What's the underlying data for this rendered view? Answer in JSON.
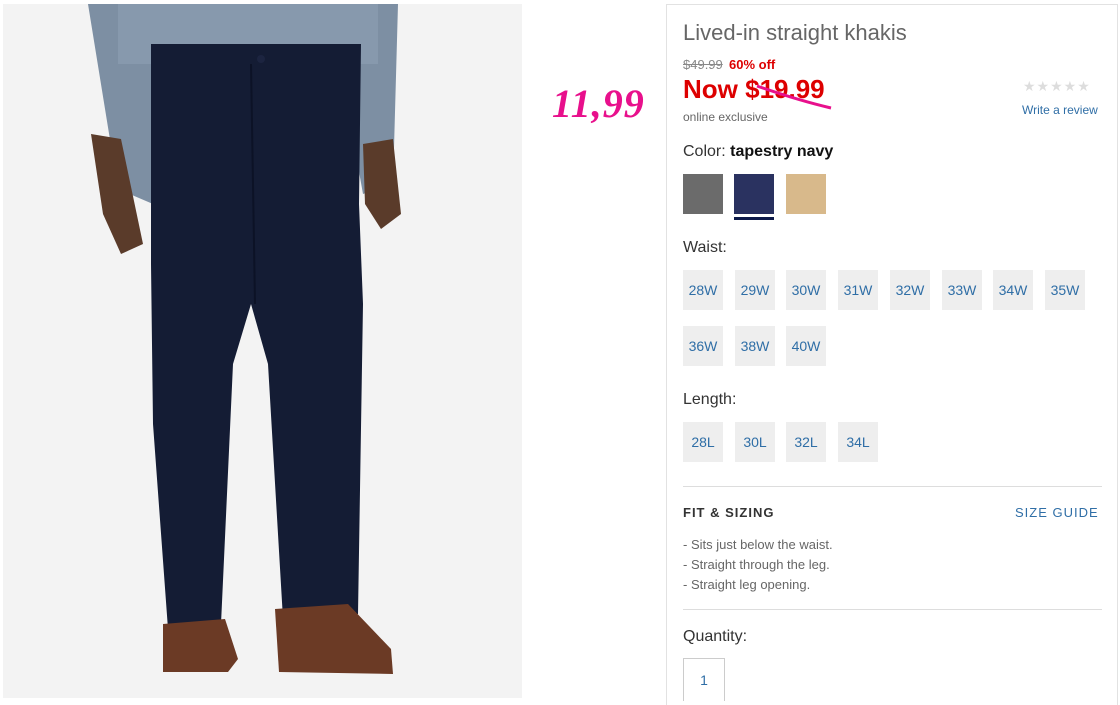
{
  "annotation": {
    "handwritten_price": "11,99"
  },
  "product": {
    "title": "Lived-in straight khakis",
    "original_price": "$49.99",
    "discount": "60% off",
    "now_price": "Now $19.99",
    "online_exclusive": "online exclusive",
    "rating_stars": "★★★★★",
    "write_review": "Write a review"
  },
  "color": {
    "label": "Color:",
    "selected": "tapestry navy",
    "swatches": [
      {
        "name": "gray",
        "hex": "#6b6b6b"
      },
      {
        "name": "tapestry navy",
        "hex": "#2a3260",
        "selected": true
      },
      {
        "name": "khaki",
        "hex": "#d8b98b"
      }
    ]
  },
  "waist": {
    "label": "Waist:",
    "options": [
      "28W",
      "29W",
      "30W",
      "31W",
      "32W",
      "33W",
      "34W",
      "35W",
      "36W",
      "38W",
      "40W"
    ]
  },
  "length": {
    "label": "Length:",
    "options": [
      "28L",
      "30L",
      "32L",
      "34L"
    ]
  },
  "fit": {
    "title": "FIT & SIZING",
    "size_guide": "SIZE GUIDE",
    "bullets": [
      "- Sits just below the waist.",
      "- Straight through the leg.",
      "- Straight leg opening."
    ]
  },
  "quantity": {
    "label": "Quantity:",
    "value": "1"
  }
}
